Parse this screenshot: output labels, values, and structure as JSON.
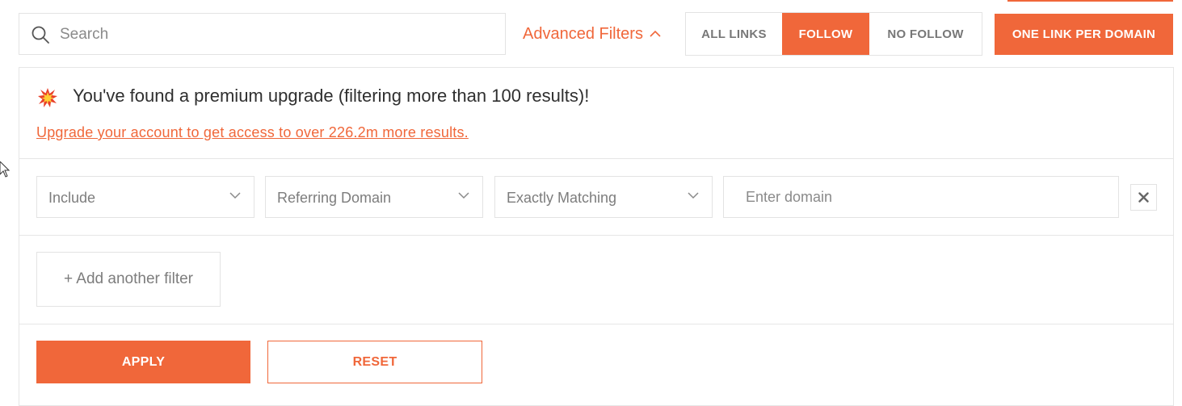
{
  "search": {
    "placeholder": "Search",
    "icon": "search-icon"
  },
  "advanced_filters": {
    "label": "Advanced Filters",
    "icon": "chevron-up-icon"
  },
  "link_type": {
    "options": [
      "ALL LINKS",
      "FOLLOW",
      "NO FOLLOW"
    ],
    "selected": "FOLLOW"
  },
  "one_link_per_domain_label": "ONE LINK PER DOMAIN",
  "premium": {
    "icon": "collision-icon",
    "message": "You've found a premium upgrade (filtering more than 100 results)!",
    "upgrade_link": "Upgrade your account to get access to over 226.2m more results."
  },
  "filter_row": {
    "include": "Include",
    "field": "Referring Domain",
    "match": "Exactly Matching",
    "domain_placeholder": "Enter domain",
    "remove_icon": "close-icon"
  },
  "add_filter_label": "+ Add another filter",
  "actions": {
    "apply": "APPLY",
    "reset": "RESET"
  },
  "colors": {
    "accent": "#f0673a",
    "border": "#e3e3e3",
    "muted_text": "#7d7d7d"
  }
}
